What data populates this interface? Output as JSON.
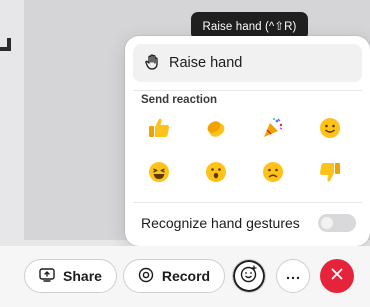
{
  "tooltip": {
    "text": "Raise hand (^⇧R)"
  },
  "popover": {
    "raise_hand": {
      "icon": "raised-hand-icon",
      "label": "Raise hand"
    },
    "section_title": "Send reaction",
    "reactions": [
      {
        "icon": "thumbs-up-icon"
      },
      {
        "icon": "clapping-hands-icon"
      },
      {
        "icon": "party-popper-icon"
      },
      {
        "icon": "smiling-face-icon"
      },
      {
        "icon": "laughing-face-icon"
      },
      {
        "icon": "surprised-face-icon"
      },
      {
        "icon": "frowning-face-icon"
      },
      {
        "icon": "thumbs-down-icon"
      }
    ],
    "gestures": {
      "label": "Recognize hand gestures",
      "enabled": false
    }
  },
  "toolbar": {
    "share_label": "Share",
    "share_icon": "share-screen-icon",
    "record_label": "Record",
    "record_icon": "record-icon",
    "reactions_icon": "reactions-icon",
    "more_icon": "more-icon",
    "end_icon": "close-icon"
  },
  "colors": {
    "end_call": "#e5243b",
    "emoji_yellow": "#f6b800",
    "tooltip_bg": "#1f1f1f"
  }
}
